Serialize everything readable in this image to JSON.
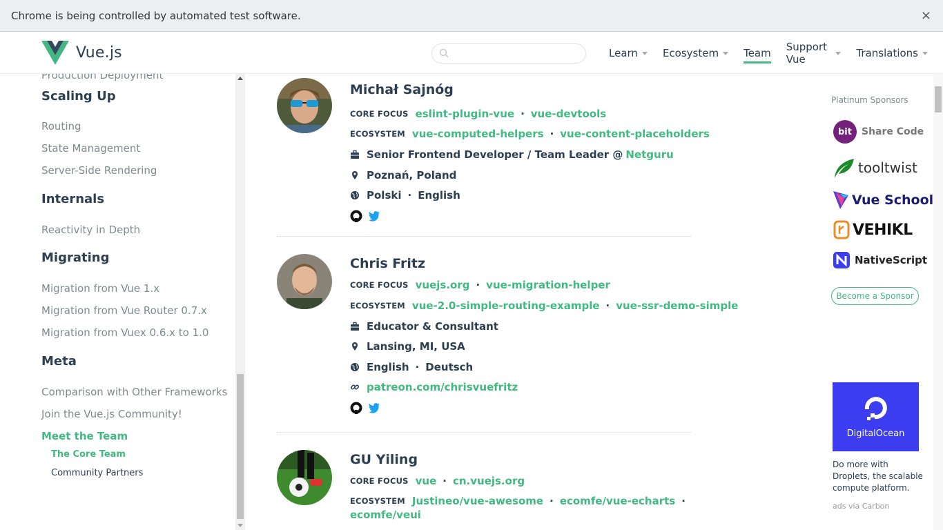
{
  "infobar": {
    "message": "Chrome is being controlled by automated test software.",
    "close": "×"
  },
  "header": {
    "logo_text": "Vue.js",
    "search": {
      "value": "",
      "placeholder": ""
    },
    "nav": [
      {
        "label": "Learn",
        "has_caret": true
      },
      {
        "label": "Ecosystem",
        "has_caret": true
      },
      {
        "label": "Team",
        "active": true
      },
      {
        "label": "Support Vue",
        "has_caret": true
      },
      {
        "label": "Translations",
        "has_caret": true
      }
    ]
  },
  "sidebar": {
    "cut_item": "Production Deployment",
    "sections": [
      {
        "heading": "Scaling Up",
        "items": [
          "Routing",
          "State Management",
          "Server-Side Rendering"
        ]
      },
      {
        "heading": "Internals",
        "items": [
          "Reactivity in Depth"
        ]
      },
      {
        "heading": "Migrating",
        "items": [
          "Migration from Vue 1.x",
          "Migration from Vue Router 0.7.x",
          "Migration from Vuex 0.6.x to 1.0"
        ]
      },
      {
        "heading": "Meta",
        "items": [
          "Comparison with Other Frameworks",
          "Join the Vue.js Community!",
          "Meet the Team"
        ]
      }
    ],
    "subitems": [
      "The Core Team",
      "Community Partners"
    ]
  },
  "members": [
    {
      "name": "Michał Sajnóg",
      "core_label": "CORE FOCUS",
      "core": [
        "eslint-plugin-vue",
        "vue-devtools"
      ],
      "eco_label": "ECOSYSTEM",
      "ecosystem": [
        "vue-computed-helpers",
        "vue-content-placeholders"
      ],
      "work": "Senior Frontend Developer / Team Leader @ ",
      "work_link": "Netguru",
      "location": "Poznań, Poland",
      "languages": [
        "Polski",
        "English"
      ]
    },
    {
      "name": "Chris Fritz",
      "core_label": "CORE FOCUS",
      "core": [
        "vuejs.org",
        "vue-migration-helper"
      ],
      "eco_label": "ECOSYSTEM",
      "ecosystem": [
        "vue-2.0-simple-routing-example",
        "vue-ssr-demo-simple"
      ],
      "work": "Educator & Consultant",
      "location": "Lansing, MI, USA",
      "languages": [
        "English",
        "Deutsch"
      ],
      "link": "patreon.com/chrisvuefritz"
    },
    {
      "name": "GU Yiling",
      "core_label": "CORE FOCUS",
      "core": [
        "vue",
        "cn.vuejs.org"
      ],
      "eco_label": "ECOSYSTEM",
      "ecosystem": [
        "Justineo/vue-awesome",
        "ecomfe/vue-echarts",
        "ecomfe/veui"
      ]
    }
  ],
  "sponsors": {
    "title": "Platinum Sponsors",
    "items": [
      {
        "name": "Share Code",
        "badge": "bit"
      },
      {
        "name": "tooltwist"
      },
      {
        "name": "Vue School"
      },
      {
        "name": "VEHIKL"
      },
      {
        "name": "NativeScript"
      }
    ],
    "become": "Become a Sponsor",
    "ad": {
      "brand": "DigitalOcean",
      "text": "Do more with Droplets, the scalable compute platform.",
      "via": "ads via Carbon"
    }
  },
  "colors": {
    "accent": "#42b983",
    "text": "#2c3e50",
    "muted": "#7f8c8d"
  }
}
